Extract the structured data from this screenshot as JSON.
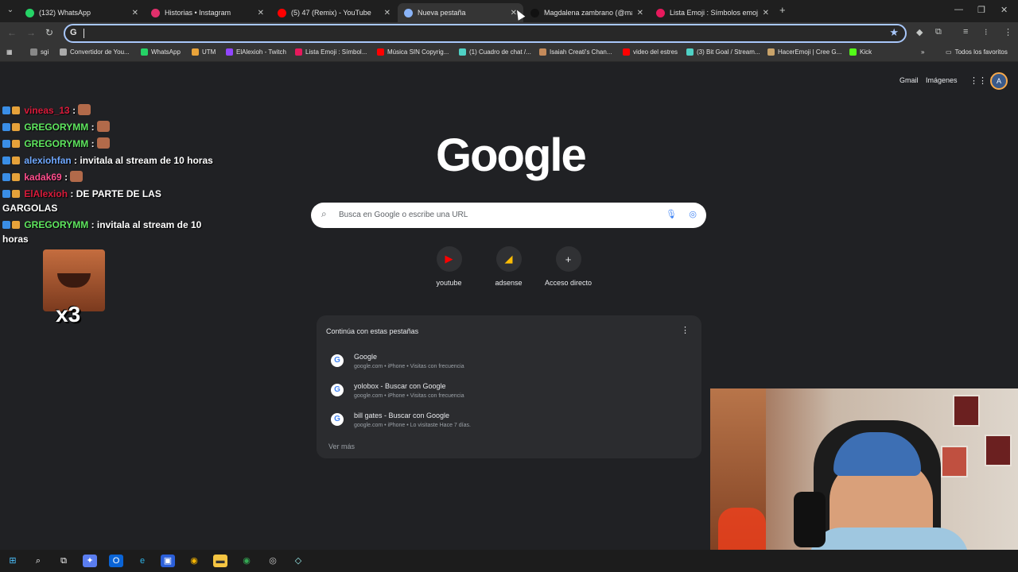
{
  "tabs": [
    {
      "title": "(132) WhatsApp",
      "favicon": "whatsapp-icon",
      "color": "#25d366"
    },
    {
      "title": "Historias • Instagram",
      "favicon": "instagram-icon",
      "color": "#e1306c"
    },
    {
      "title": "(5) 47 (Remix) - YouTube",
      "favicon": "youtube-icon",
      "color": "#ff0000"
    },
    {
      "title": "Nueva pestaña",
      "favicon": "chrome-icon",
      "color": "#8ab4f8"
    },
    {
      "title": "Magdalena zambrano (@magd",
      "favicon": "tiktok-icon",
      "color": "#111111"
    },
    {
      "title": "Lista Emoji : Símbolos emoji na",
      "favicon": "emoji-icon",
      "color": "#e6195c"
    }
  ],
  "omnibox": {
    "value": ""
  },
  "bookmarks": [
    {
      "label": "sgi",
      "color": "#888888"
    },
    {
      "label": "Convertidor de You...",
      "color": "#aaaaaa"
    },
    {
      "label": "WhatsApp",
      "color": "#25d366"
    },
    {
      "label": "UTM",
      "color": "#e8a33a"
    },
    {
      "label": "ElAlexioh - Twitch",
      "color": "#9146ff"
    },
    {
      "label": "Lista Emoji : Símbol...",
      "color": "#e6195c"
    },
    {
      "label": "Música SIN Copyrig...",
      "color": "#ff0000"
    },
    {
      "label": "(1) Cuadro de chat /...",
      "color": "#4fd1c5"
    },
    {
      "label": "Isaiah Creati's Chan...",
      "color": "#c48a5a"
    },
    {
      "label": "video del estres",
      "color": "#ff0000"
    },
    {
      "label": "(3) Bit Goal / Stream...",
      "color": "#4fd1c5"
    },
    {
      "label": "HacerEmoji | Cree G...",
      "color": "#c9a36a"
    },
    {
      "label": "Kick",
      "color": "#53fc18"
    }
  ],
  "all_bookmarks": "Todos los favoritos",
  "top_links": {
    "gmail": "Gmail",
    "images": "Imágenes"
  },
  "logo": "Google",
  "search": {
    "placeholder": "Busca en Google o escribe una URL"
  },
  "shortcuts": [
    {
      "label": "youtube",
      "icon": "youtube-icon",
      "color": "#ff0000"
    },
    {
      "label": "adsense",
      "icon": "adsense-icon",
      "color": "#fbbc04"
    },
    {
      "label": "Acceso directo",
      "icon": "plus-icon",
      "color": "#e8eaed"
    }
  ],
  "continue": {
    "heading": "Continúa con estas pestañas",
    "rows": [
      {
        "title": "Google",
        "meta": "google.com • iPhone • Visitas con frecuencia"
      },
      {
        "title": "yolobox - Buscar con Google",
        "meta": "google.com • iPhone • Visitas con frecuencia"
      },
      {
        "title": "bill gates - Buscar con Google",
        "meta": "google.com • iPhone • Lo visitaste Hace 7 días."
      }
    ],
    "more": "Ver más"
  },
  "chat": {
    "messages": [
      {
        "user": "vineas_13",
        "user_color": "#d91a3a",
        "text": ":"
      },
      {
        "user": "GREGORYMM",
        "user_color": "#5ee65e",
        "text": ":"
      },
      {
        "user": "GREGORYMM",
        "user_color": "#5ee65e",
        "text": ":"
      },
      {
        "user": "alexiohfan",
        "user_color": "#6fa8ff",
        "text": ": invitala al stream de 10 horas"
      },
      {
        "user": "kadak69",
        "user_color": "#ff4d8d",
        "text": ":"
      },
      {
        "user": "ElAlexioh",
        "user_color": "#d91a3a",
        "text": ": DE PARTE DE LAS GARGOLAS"
      },
      {
        "user": "GREGORYMM",
        "user_color": "#5ee65e",
        "text": ": invitala al stream de 10 horas"
      }
    ],
    "multiplier": "x3"
  }
}
